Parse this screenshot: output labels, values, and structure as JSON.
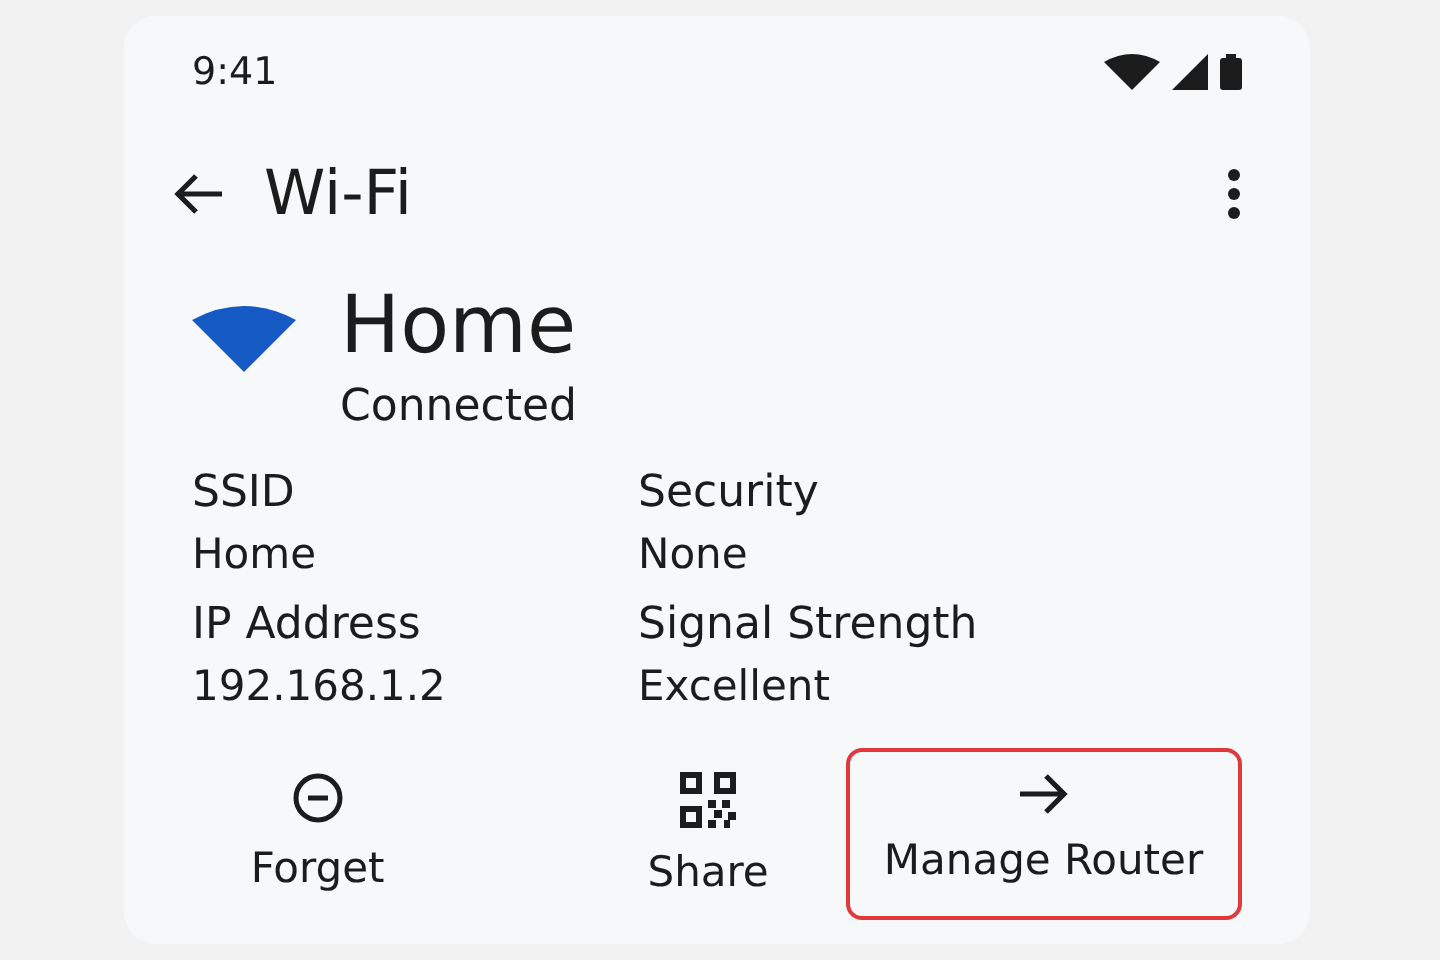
{
  "status_bar": {
    "time": "9:41"
  },
  "toolbar": {
    "title": "Wi-Fi"
  },
  "network": {
    "name": "Home",
    "status": "Connected"
  },
  "details": [
    {
      "label": "SSID",
      "value": "Home"
    },
    {
      "label": "Security",
      "value": "None"
    },
    {
      "label": "IP Address",
      "value": "192.168.1.2"
    },
    {
      "label": "Signal Strength",
      "value": "Excellent"
    }
  ],
  "actions": [
    {
      "kind": "forget",
      "label": "Forget",
      "selected": false
    },
    {
      "kind": "share",
      "label": "Share",
      "selected": false
    },
    {
      "kind": "manage",
      "label": "Manage Router",
      "selected": true
    }
  ]
}
